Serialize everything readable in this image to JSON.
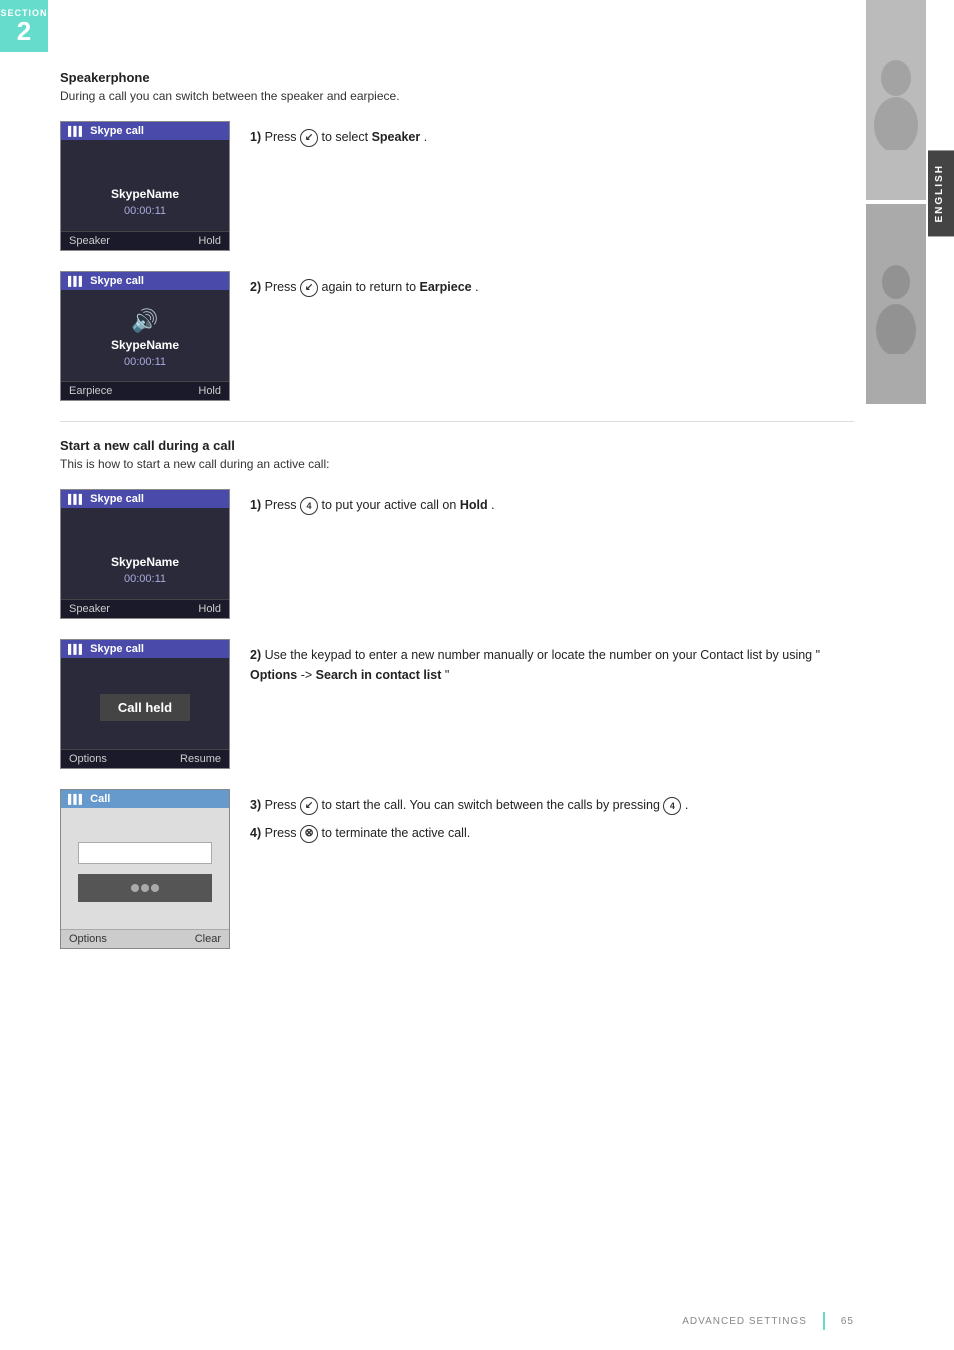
{
  "section": {
    "label": "SECTION",
    "number": "2"
  },
  "english_tab": "ENGLISH",
  "speakerphone": {
    "heading": "Speakerphone",
    "description": "During a call you can switch between the speaker and earpiece.",
    "steps": [
      {
        "num": "1)",
        "text_before": "Press",
        "button_symbol": "↙",
        "text_after": "to select",
        "bold": "Speaker",
        "screen": {
          "title": "Skype call",
          "signal": "((•))",
          "name": "SkypeName",
          "time": "00:00:11",
          "footer_left": "Speaker",
          "footer_right": "Hold",
          "show_icon": false
        }
      },
      {
        "num": "2)",
        "text_before": "Press",
        "button_symbol": "↙",
        "text_after": "again to return to",
        "bold": "Earpiece",
        "screen": {
          "title": "Skype call",
          "signal": "((•))",
          "name": "SkypeName",
          "time": "00:00:11",
          "footer_left": "Earpiece",
          "footer_right": "Hold",
          "show_icon": true
        }
      }
    ]
  },
  "new_call": {
    "heading": "Start a new call during a call",
    "description": "This is how to start a new call during an active call:",
    "steps": [
      {
        "num": "1)",
        "text_before": "Press",
        "button_symbol": "4",
        "text_after": "to put your active call on",
        "bold": "Hold",
        "screen": {
          "type": "skype",
          "title": "Skype call",
          "signal": "((•))",
          "name": "SkypeName",
          "time": "00:00:11",
          "footer_left": "Speaker",
          "footer_right": "Hold"
        }
      },
      {
        "num": "2)",
        "text": "Use the keypad to enter a new number manually or locate the number on your Contact list by using \"",
        "bold1": "Options",
        "arrow": "->",
        "bold2": "Search in contact list",
        "text_end": "\"",
        "screen": {
          "type": "call-held",
          "title": "Skype call",
          "signal": "((•))",
          "held_text": "Call held",
          "footer_left": "Options",
          "footer_right": "Resume"
        }
      },
      {
        "num": "3)",
        "text_before": "Press",
        "button_symbol": "↙",
        "text_after": "to start the call. You can switch between the calls by pressing",
        "button2_symbol": "4",
        "screen": {
          "type": "call",
          "title": "Call",
          "signal": "((•))",
          "footer_left": "Options",
          "footer_right": "Clear"
        }
      },
      {
        "num": "4)",
        "text_before": "Press",
        "button_symbol": "⊗",
        "text_after": "to terminate the active call."
      }
    ]
  },
  "footer": {
    "text": "ADVANCED SETTINGS",
    "page": "65"
  }
}
